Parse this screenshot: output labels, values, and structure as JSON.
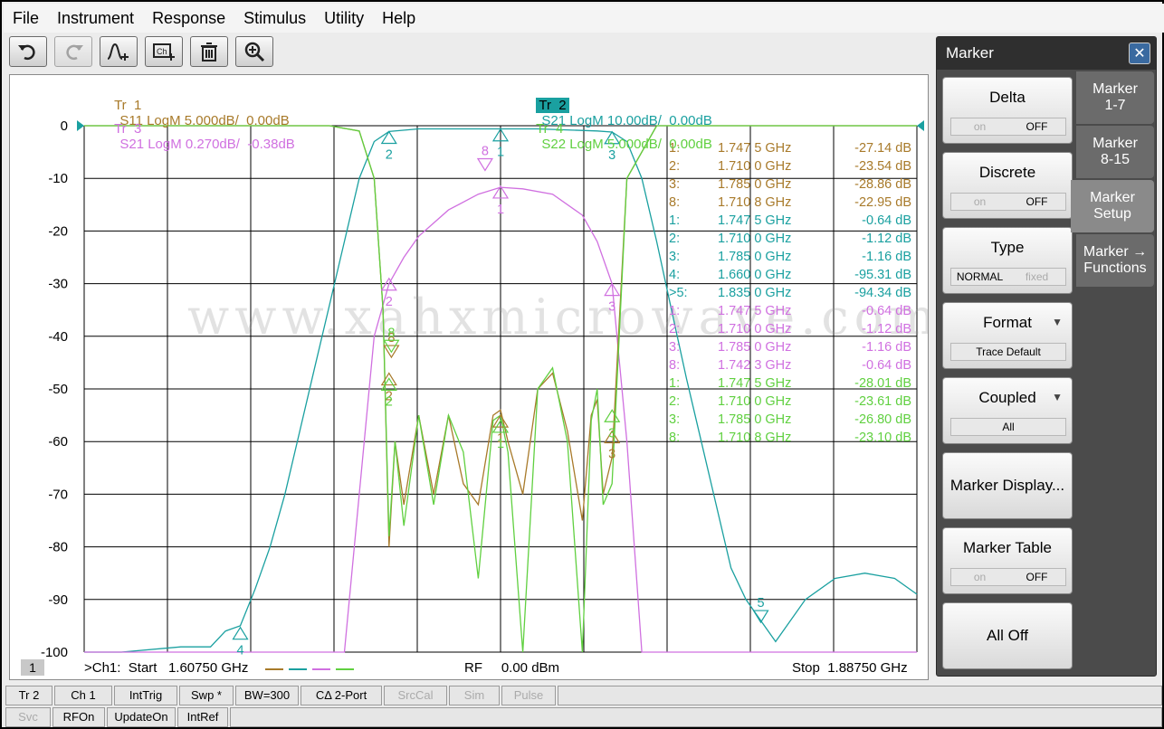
{
  "menu": [
    "File",
    "Instrument",
    "Response",
    "Stimulus",
    "Utility",
    "Help"
  ],
  "toolbar": {
    "icons": [
      "undo-icon",
      "redo-icon",
      "add-trace-icon",
      "channel-icon",
      "delete-icon",
      "zoom-icon"
    ]
  },
  "traces": {
    "tr1": {
      "tag": "Tr  1",
      "desc": "S11 LogM 5.000dB/  0.00dB",
      "color": "#a87a2a"
    },
    "tr2": {
      "tag": "Tr  2",
      "desc": "S21 LogM 10.00dB/  0.00dB",
      "color": "#1aa0a0"
    },
    "tr3": {
      "tag": "Tr  3",
      "desc": "S21 LogM 0.270dB/  -0.38dB",
      "color": "#d070e0"
    },
    "tr4": {
      "tag": "Tr  4",
      "desc": "S22 LogM 5.000dB/  0.00dB",
      "color": "#60d040"
    }
  },
  "chart_data": {
    "type": "line",
    "x_unit": "GHz",
    "xlim": [
      1.6075,
      1.8875
    ],
    "ylim": [
      -100,
      0
    ],
    "y_ticks": [
      "0",
      "-10",
      "-20",
      "-30",
      "-40",
      "-50",
      "-60",
      "-70",
      "-80",
      "-90",
      "-100"
    ],
    "grid": true,
    "series": [
      {
        "name": "S21 (Tr 2)",
        "x": [
          1.6075,
          1.62,
          1.64,
          1.65,
          1.655,
          1.66,
          1.665,
          1.67,
          1.675,
          1.68,
          1.685,
          1.69,
          1.695,
          1.7,
          1.705,
          1.71,
          1.72,
          1.74,
          1.76,
          1.78,
          1.785,
          1.79,
          1.795,
          1.8,
          1.805,
          1.81,
          1.815,
          1.82,
          1.825,
          1.83,
          1.835,
          1.84,
          1.85,
          1.86,
          1.87,
          1.88,
          1.8875
        ],
        "y": [
          -100,
          -100,
          -99,
          -99,
          -96,
          -95,
          -88,
          -80,
          -70,
          -58,
          -46,
          -34,
          -22,
          -10,
          -3,
          -1.1,
          -0.6,
          -0.6,
          -0.6,
          -1.0,
          -1.2,
          -3,
          -10,
          -22,
          -35,
          -48,
          -60,
          -72,
          -84,
          -90,
          -94,
          -98,
          -90,
          -86,
          -85,
          -86,
          -89
        ]
      },
      {
        "name": "S21 (Tr 3)",
        "x": [
          1.6075,
          1.695,
          1.7,
          1.705,
          1.71,
          1.715,
          1.72,
          1.73,
          1.74,
          1.7475,
          1.755,
          1.765,
          1.775,
          1.78,
          1.785,
          1.79,
          1.795,
          1.8,
          1.8875
        ],
        "y": [
          -100,
          -100,
          -70,
          -40,
          -30,
          -25,
          -21,
          -16,
          -13,
          -11.7,
          -12,
          -13,
          -17,
          -22,
          -30,
          -60,
          -100,
          -100,
          -100
        ]
      },
      {
        "name": "S11 (Tr 1)",
        "x": [
          1.6075,
          1.69,
          1.7,
          1.705,
          1.708,
          1.71,
          1.712,
          1.715,
          1.72,
          1.725,
          1.73,
          1.735,
          1.74,
          1.745,
          1.7475,
          1.75,
          1.755,
          1.76,
          1.765,
          1.77,
          1.775,
          1.778,
          1.78,
          1.782,
          1.785,
          1.79,
          1.8,
          1.8875
        ],
        "y": [
          0,
          0,
          -1,
          -10,
          -35,
          -80,
          -60,
          -72,
          -55,
          -70,
          -55,
          -68,
          -72,
          -55,
          -54,
          -60,
          -70,
          -50,
          -47,
          -58,
          -75,
          -55,
          -52,
          -70,
          -63,
          -10,
          0,
          0
        ]
      },
      {
        "name": "S22 (Tr 4)",
        "x": [
          1.6075,
          1.69,
          1.7,
          1.705,
          1.708,
          1.71,
          1.712,
          1.715,
          1.72,
          1.725,
          1.73,
          1.735,
          1.74,
          1.745,
          1.7475,
          1.75,
          1.755,
          1.76,
          1.765,
          1.77,
          1.775,
          1.778,
          1.78,
          1.782,
          1.785,
          1.79,
          1.8,
          1.8875
        ],
        "y": [
          0,
          0,
          -1,
          -10,
          -35,
          -78,
          -60,
          -76,
          -55,
          -72,
          -55,
          -62,
          -86,
          -56,
          -55,
          -62,
          -100,
          -50,
          -46,
          -60,
          -100,
          -56,
          -50,
          -72,
          -68,
          -10,
          0,
          0
        ]
      }
    ]
  },
  "markers": [
    {
      "label": "1:",
      "freq": "1.747 5 GHz",
      "val": "-27.14 dB",
      "color": "#a87a2a"
    },
    {
      "label": "2:",
      "freq": "1.710 0 GHz",
      "val": "-23.54 dB",
      "color": "#a87a2a"
    },
    {
      "label": "3:",
      "freq": "1.785 0 GHz",
      "val": "-28.86 dB",
      "color": "#a87a2a"
    },
    {
      "label": "8:",
      "freq": "1.710 8 GHz",
      "val": "-22.95 dB",
      "color": "#a87a2a"
    },
    {
      "label": "1:",
      "freq": "1.747 5 GHz",
      "val": "-0.64 dB",
      "color": "#1aa0a0"
    },
    {
      "label": "2:",
      "freq": "1.710 0 GHz",
      "val": "-1.12 dB",
      "color": "#1aa0a0"
    },
    {
      "label": "3:",
      "freq": "1.785 0 GHz",
      "val": "-1.16 dB",
      "color": "#1aa0a0"
    },
    {
      "label": "4:",
      "freq": "1.660 0 GHz",
      "val": "-95.31 dB",
      "color": "#1aa0a0"
    },
    {
      "label": ">5:",
      "freq": "1.835 0 GHz",
      "val": "-94.34 dB",
      "color": "#1aa0a0"
    },
    {
      "label": "1:",
      "freq": "1.747 5 GHz",
      "val": "-0.64 dB",
      "color": "#d070e0"
    },
    {
      "label": "2:",
      "freq": "1.710 0 GHz",
      "val": "-1.12 dB",
      "color": "#d070e0"
    },
    {
      "label": "3:",
      "freq": "1.785 0 GHz",
      "val": "-1.16 dB",
      "color": "#d070e0"
    },
    {
      "label": "8:",
      "freq": "1.742 3 GHz",
      "val": "-0.64 dB",
      "color": "#d070e0"
    },
    {
      "label": "1:",
      "freq": "1.747 5 GHz",
      "val": "-28.01 dB",
      "color": "#60d040"
    },
    {
      "label": "2:",
      "freq": "1.710 0 GHz",
      "val": "-23.61 dB",
      "color": "#60d040"
    },
    {
      "label": "3:",
      "freq": "1.785 0 GHz",
      "val": "-26.80 dB",
      "color": "#60d040"
    },
    {
      "label": "8:",
      "freq": "1.710 8 GHz",
      "val": "-23.10 dB",
      "color": "#60d040"
    }
  ],
  "watermark": "www.xahxmicrowave.com",
  "footer": {
    "channel_num": "1",
    "start": ">Ch1:  Start   1.60750 GHz",
    "rf": "RF     0.00 dBm",
    "stop": "Stop  1.88750 GHz"
  },
  "marker_panel": {
    "title": "Marker",
    "close": "✕",
    "buttons": [
      {
        "label": "Delta",
        "toggle": [
          "on",
          "OFF"
        ]
      },
      {
        "label": "Discrete",
        "toggle": [
          "on",
          "OFF"
        ]
      },
      {
        "label": "Type",
        "toggle": [
          "NORMAL",
          "fixed"
        ]
      },
      {
        "label": "Format",
        "sub": "Trace Default"
      },
      {
        "label": "Coupled",
        "sub": "All"
      },
      {
        "label": "Marker Display..."
      },
      {
        "label": "Marker Table",
        "toggle": [
          "on",
          "OFF"
        ]
      },
      {
        "label": "All Off"
      }
    ],
    "tabs": [
      {
        "l1": "Marker",
        "l2": "1-7"
      },
      {
        "l1": "Marker",
        "l2": "8-15"
      },
      {
        "l1": "Marker",
        "l2": "Setup"
      },
      {
        "l1": "Marker →",
        "l2": "Functions"
      }
    ]
  },
  "status1": [
    "Tr 2",
    "Ch 1",
    "IntTrig",
    "Swp *",
    "BW=300",
    "CΔ 2-Port",
    "SrcCal",
    "Sim",
    "Pulse"
  ],
  "status2": [
    "Svc",
    "RFOn",
    "UpdateOn",
    "IntRef"
  ]
}
